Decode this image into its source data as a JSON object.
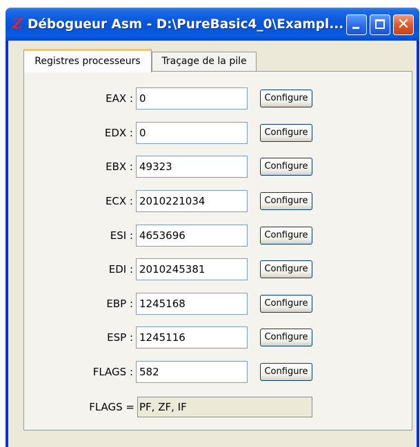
{
  "window": {
    "icon": "purebasic-z-icon",
    "title": "Débogueur Asm - D:\\PureBasic4_0\\Exampl...",
    "buttons": [
      "minimize-icon",
      "maximize-icon",
      "close-icon"
    ]
  },
  "tabs": [
    {
      "label": "Registres processeurs",
      "active": true
    },
    {
      "label": "Traçage de la pile",
      "active": false
    }
  ],
  "registers": [
    {
      "label": "EAX :",
      "value": "0",
      "button": "Configure"
    },
    {
      "label": "EDX :",
      "value": "0",
      "button": "Configure"
    },
    {
      "label": "EBX :",
      "value": "49323",
      "button": "Configure"
    },
    {
      "label": "ECX :",
      "value": "2010221034",
      "button": "Configure"
    },
    {
      "label": "ESI :",
      "value": "4653696",
      "button": "Configure"
    },
    {
      "label": "EDI :",
      "value": "2010245381",
      "button": "Configure"
    },
    {
      "label": "EBP :",
      "value": "1245168",
      "button": "Configure"
    },
    {
      "label": "ESP :",
      "value": "1245116",
      "button": "Configure"
    },
    {
      "label": "FLAGS :",
      "value": "582",
      "button": "Configure"
    }
  ],
  "flags_summary": {
    "label": "FLAGS =",
    "value": "PF, ZF, IF"
  },
  "colors": {
    "titlebar": "#0a58dc",
    "client": "#ece9d8",
    "active_tab_highlight": "#ffc83c",
    "close_button": "#e05a2c"
  }
}
